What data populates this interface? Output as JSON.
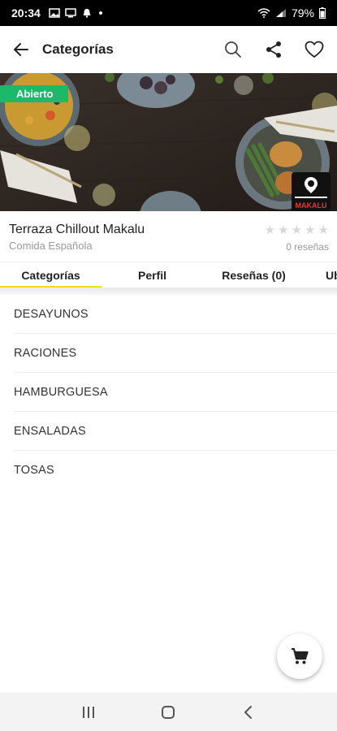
{
  "status_bar": {
    "time": "20:34",
    "battery": "79%"
  },
  "app_bar": {
    "title": "Categorías",
    "icons": [
      "back-arrow-icon",
      "search-icon",
      "share-icon",
      "heart-icon"
    ]
  },
  "hero": {
    "badge": "Abierto"
  },
  "restaurant": {
    "name": "Terraza Chillout Makalu",
    "cuisine": "Comida Española",
    "reviews": "0 reseñas",
    "rating": 0,
    "logo_text": "MAKALU"
  },
  "tabs": [
    {
      "label": "Categorías"
    },
    {
      "label": "Perfil"
    },
    {
      "label": "Reseñas (0)"
    },
    {
      "label": "Ub"
    }
  ],
  "categories": [
    {
      "label": "DESAYUNOS"
    },
    {
      "label": "RACIONES"
    },
    {
      "label": "HAMBURGUESA"
    },
    {
      "label": "ENSALADAS"
    },
    {
      "label": "TOSAS"
    }
  ],
  "colors": {
    "accent": "#f2df13",
    "open_badge": "#1db96a"
  }
}
